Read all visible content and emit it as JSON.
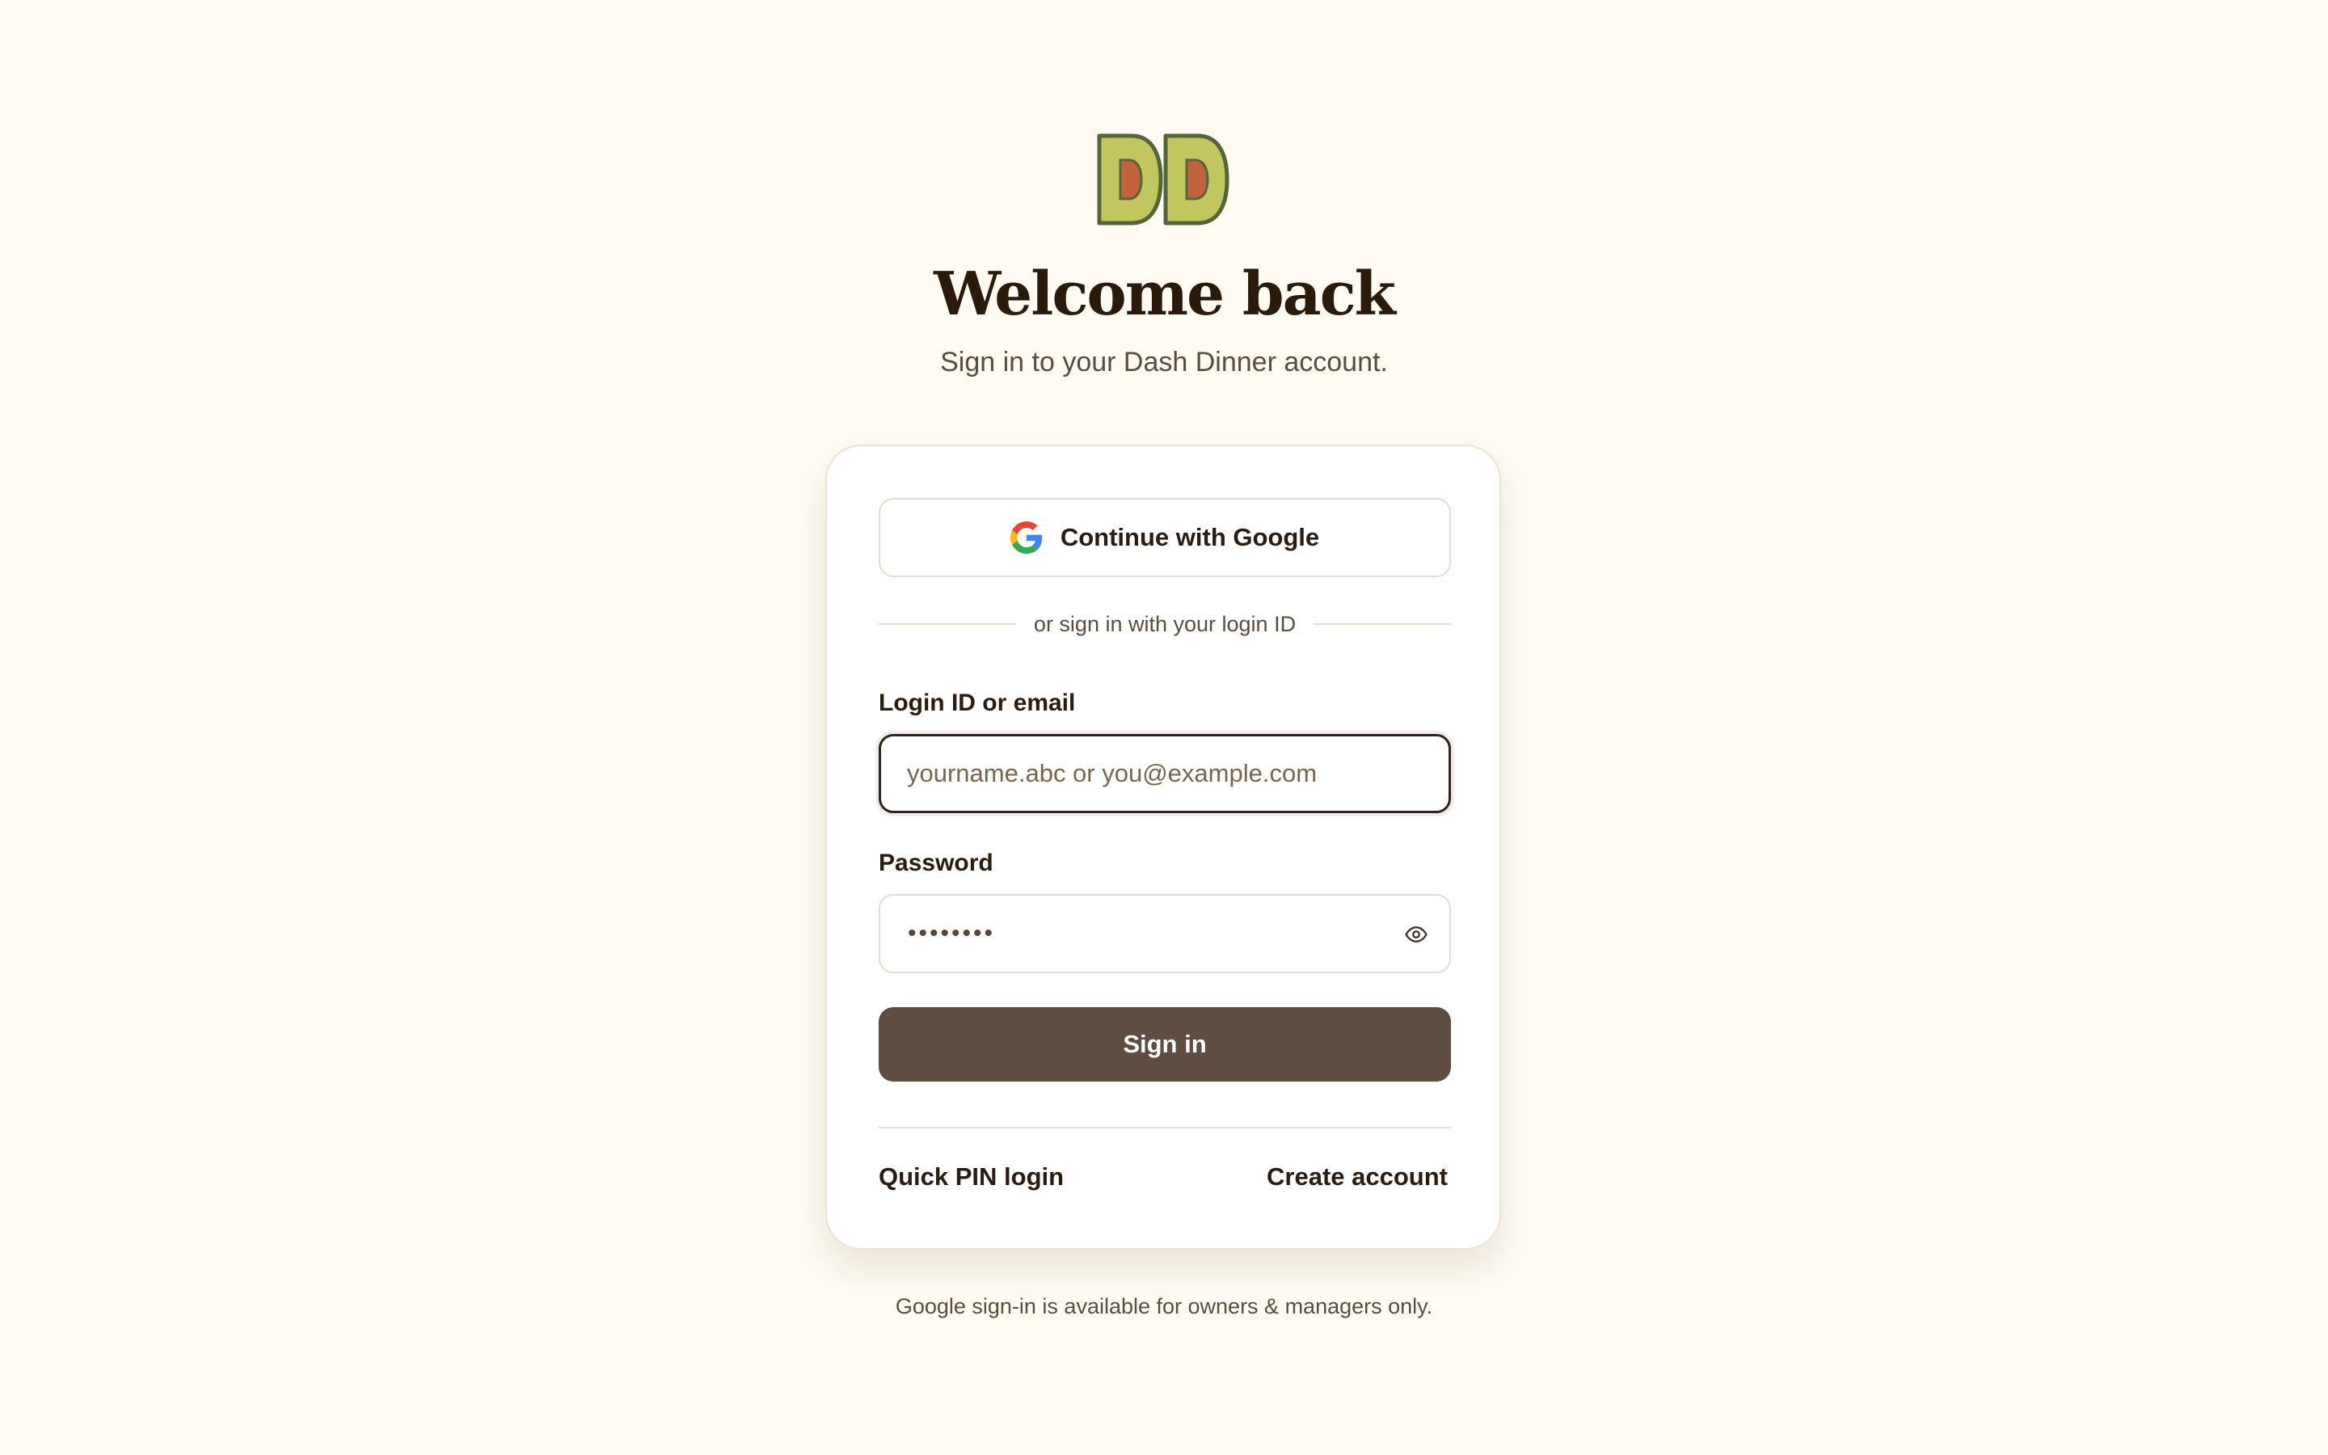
{
  "brand": {
    "logo_icon": "dash-dinner-dd-logo",
    "colors": {
      "background": "#fffbf3",
      "logo_fill": "#c2c65e",
      "logo_outline": "#55653a",
      "logo_inner": "#c0623d",
      "primary_button": "#5e4d40",
      "text_dark": "#2a1d10",
      "text_muted": "#5e4c3a"
    }
  },
  "header": {
    "title": "Welcome back",
    "subtitle": "Sign in to your Dash Dinner account."
  },
  "card": {
    "google_button": {
      "icon": "google-g-icon",
      "label": "Continue with Google"
    },
    "divider_text": "or sign in with your login ID",
    "login_field": {
      "label": "Login ID or email",
      "placeholder": "yourname.abc or you@example.com",
      "value": ""
    },
    "password_field": {
      "label": "Password",
      "masked_value": "••••••••",
      "toggle_icon": "eye-icon"
    },
    "submit_label": "Sign in",
    "links": {
      "quick_pin": "Quick PIN login",
      "create_account": "Create account"
    }
  },
  "footer": {
    "note": "Google sign-in is available for owners & managers only."
  }
}
